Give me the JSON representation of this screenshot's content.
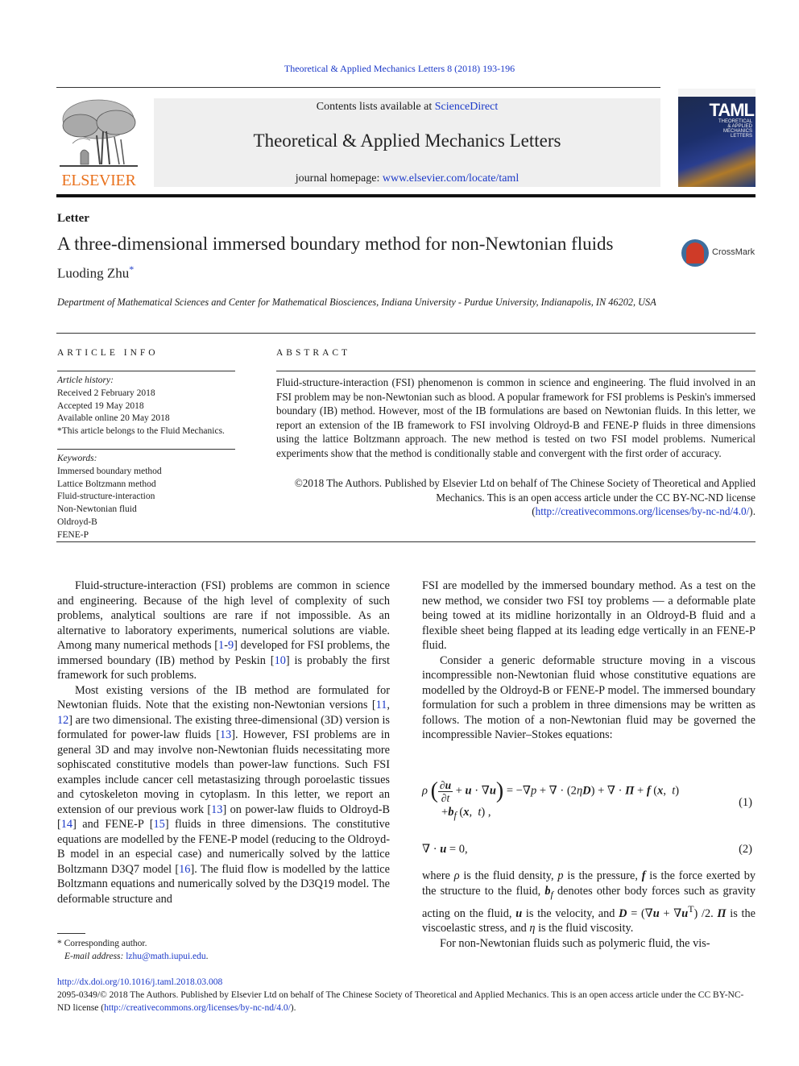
{
  "running_header": "Theoretical & Applied Mechanics Letters 8 (2018) 193-196",
  "publisher_logo": {
    "text": "ELSEVIER",
    "color": "#e9711c"
  },
  "banner": {
    "contents_prefix": "Contents lists available at ",
    "contents_link": "ScienceDirect",
    "journal_title": "Theoretical & Applied Mechanics Letters",
    "homepage_prefix": "journal homepage: ",
    "homepage_link": "www.elsevier.com/locate/taml"
  },
  "cover": {
    "acronym": "TAML",
    "subtitle_lines": [
      "THEORETICAL",
      "& APPLIED",
      "MECHANICS",
      "LETTERS"
    ]
  },
  "article": {
    "type": "Letter",
    "title": "A three-dimensional immersed boundary method for non-Newtonian fluids",
    "author": "Luoding Zhu",
    "author_mark": "*",
    "crossmark_label": "CrossMark",
    "affiliation": "Department of Mathematical Sciences and Center for Mathematical Biosciences, Indiana University - Purdue University, Indianapolis, IN 46202, USA"
  },
  "article_info": {
    "heading": "ARTICLE INFO",
    "history_label": "Article history:",
    "history": [
      "Received 2 February 2018",
      "Accepted 19 May 2018",
      "Available online 20 May 2018",
      "*This article belongs to the Fluid Mechanics."
    ],
    "keywords_label": "Keywords:",
    "keywords": [
      "Immersed boundary method",
      "Lattice Boltzmann method",
      "Fluid-structure-interaction",
      "Non-Newtonian fluid",
      "Oldroyd-B",
      "FENE-P"
    ]
  },
  "abstract": {
    "heading": "ABSTRACT",
    "body": "Fluid-structure-interaction (FSI) phenomenon is common in science and engineering. The fluid involved in an FSI problem may be non-Newtonian such as blood. A popular framework for FSI problems is Peskin's immersed boundary (IB) method. However, most of the IB formulations are based on Newtonian fluids. In this letter, we report an extension of the IB framework to FSI involving Oldroyd-B and FENE-P fluids in three dimensions using the lattice Boltzmann approach. The new method is tested on two FSI model problems. Numerical experiments show that the method is conditionally stable and convergent with the first order of accuracy.",
    "copyright": "©2018 The Authors. Published by Elsevier Ltd on behalf of The Chinese Society of Theoretical and Applied Mechanics. This is an open access article under the CC BY-NC-ND license",
    "license_link": "http://creativecommons.org/licenses/by-nc-nd/4.0/"
  },
  "body": {
    "p1": [
      "Fluid-structure-interaction (FSI) problems are common in science and engineering. Because of the high level of complexity of such problems, analytical soultions are rare if not impossible. As an alternative to laboratory experiments, numerical solutions are viable. Among many numerical methods [",
      "1",
      "-",
      "9",
      "] developed for FSI problems, the immersed boundary (IB) method by Peskin [",
      "10",
      "] is probably the first framework for such problems."
    ],
    "p2": [
      "Most existing versions of the IB method are formulated for Newtonian fluids. Note that the existing non-Newtonian versions [",
      "11",
      ", ",
      "12",
      "] are two dimensional. The existing three-dimensional (3D) version is formulated for power-law fluids [",
      "13",
      "]. However, FSI problems are in general 3D and may involve non-Newtonian fluids necessitating more sophiscated constitutive models than power-law functions. Such FSI examples include cancer cell metastasizing through poroelastic tissues and cytoskeleton moving in cytoplasm. In this letter, we report an extension of our previous work [",
      "13",
      "] on power-law fluids to Oldroyd-B [",
      "14",
      "] and FENE-P [",
      "15",
      "] fluids in three dimensions. The constitutive equations are modelled by the FENE-P model (reducing to the Oldroyd-B model in an especial case) and numerically solved by the lattice Boltzmann D3Q7 model [",
      "16",
      "]. The fluid flow is modelled by the lattice Boltzmann equations and numerically solved by the D3Q19 model. The deformable structure and"
    ],
    "p3": "FSI are modelled by the immersed boundary method. As a test on the new method, we consider two FSI toy problems — a deformable plate being towed at its midline horizontally in an Oldroyd-B fluid and a flexible sheet being flapped at its leading edge vertically in an FENE-P fluid.",
    "p4": "Consider a generic deformable structure moving in a viscous incompressible non-Newtonian fluid whose constitutive equations are modelled by the Oldroyd-B or FENE-P model. The immersed boundary formulation for such a problem in three dimensions may be written as follows. The motion of a non-Newtonian fluid may be governed the incompressible Navier–Stokes equations:",
    "eq1_number": "(1)",
    "eq2_number": "(2)",
    "p5_parts": [
      "where ",
      "ρ",
      " is the fluid density, ",
      "p",
      " is the pressure, ",
      "f",
      " is the force exerted by the structure to the fluid, ",
      "b",
      "f",
      " denotes other body forces such as gravity acting on the fluid, ",
      "u",
      " is the velocity, and ",
      "D",
      " = (∇",
      "u",
      " + ∇",
      "u",
      "T",
      ") /2. ",
      "Π",
      " is the viscoelastic stress, and ",
      "η",
      " is the fluid viscosity."
    ],
    "p6": "For non-Newtonian fluids such as polymeric fluid, the vis-"
  },
  "footnotes": {
    "corresponding": "* Corresponding author.",
    "email_label": "E-mail address:",
    "email": "lzhu@math.iupui.edu",
    "email_suffix": "."
  },
  "footer": {
    "doi": "http://dx.doi.org/10.1016/j.taml.2018.03.008",
    "copyright": "2095-0349/© 2018 The Authors. Published by Elsevier Ltd on behalf of The Chinese Society of Theoretical and Applied Mechanics. This is an open access article under the CC BY-NC-ND license (",
    "license_link": "http://creativecommons.org/licenses/by-nc-nd/4.0/",
    "suffix": ")."
  }
}
